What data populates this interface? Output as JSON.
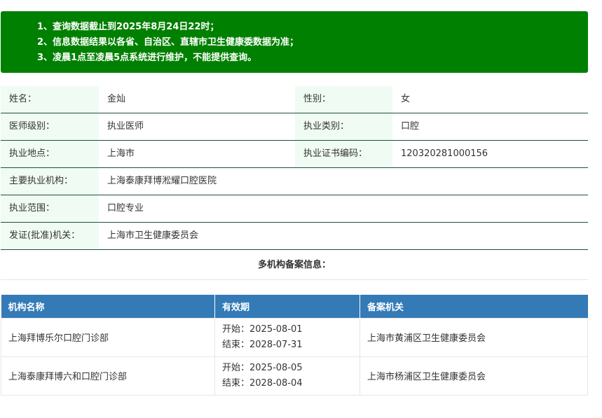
{
  "notice": {
    "line1_prefix": "1、查询数据截止到",
    "line1_date": "2025年8月24日22时；",
    "line2": "2、信息数据结果以各省、自治区、直辖市卫生健康委数据为准；",
    "line3_prefix": "3、",
    "line3_bold": "凌晨1点至凌晨5点",
    "line3_suffix": "系统进行维护，不能提供查询。"
  },
  "info": {
    "name_label": "姓名：",
    "name_value": "金灿",
    "gender_label": "性别：",
    "gender_value": "女",
    "level_label": "医师级别：",
    "level_value": "执业医师",
    "category_label": "执业类别：",
    "category_value": "口腔",
    "location_label": "执业地点：",
    "location_value": "上海市",
    "cert_label": "执业证书编码：",
    "cert_value": "120320281000156",
    "org_label": "主要执业机构：",
    "org_value": "上海泰康拜博淞耀口腔医院",
    "scope_label": "执业范围：",
    "scope_value": "口腔专业",
    "issuer_label": "发证(批准)机关：",
    "issuer_value": "上海市卫生健康委员会"
  },
  "multi": {
    "title": "多机构备案信息："
  },
  "org_table": {
    "headers": [
      "机构名称",
      "有效期",
      "备案机关"
    ],
    "rows": [
      {
        "name": "上海拜博乐尔口腔门诊部",
        "start": "开始：2025-08-01",
        "end": "结束：2028-07-31",
        "authority": "上海市黄浦区卫生健康委员会"
      },
      {
        "name": "上海泰康拜博六和口腔门诊部",
        "start": "开始：2025-08-05",
        "end": "结束：2028-08-04",
        "authority": "上海市杨浦区卫生健康委员会"
      }
    ]
  },
  "colors": {
    "notice_bg": "#008000",
    "label_bg": "#f0fbf3",
    "header_bg": "#337ab7"
  }
}
